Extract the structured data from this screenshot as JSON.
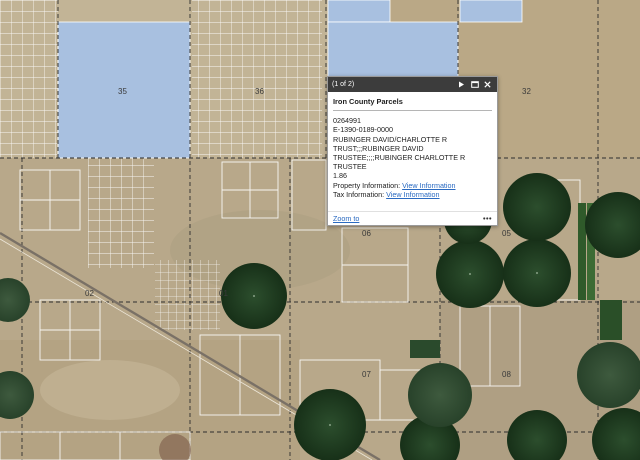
{
  "map": {
    "section_labels": [
      "35",
      "36",
      "32",
      "02",
      "01",
      "06",
      "05",
      "07",
      "08"
    ]
  },
  "popup": {
    "count": "(1 of 2)",
    "title": "Iron County Parcels",
    "parcel_id": "0264991",
    "account": "E-1390-0189-0000",
    "owner_line1": "RUBINGER DAVID/CHARLOTTE R",
    "owner_line2": "TRUST;;;RUBINGER DAVID",
    "owner_line3": "TRUSTEE;;;;RUBINGER CHARLOTTE R",
    "owner_line4": "TRUSTEE",
    "acres": "1.86",
    "property_label": "Property Information:",
    "property_link": "View Information",
    "tax_label": "Tax Information:",
    "tax_link": "View Information",
    "zoom_label": "Zoom to",
    "more_label": "•••"
  },
  "icons": {
    "next": "play-next-icon",
    "maximize": "maximize-icon",
    "close": "close-icon"
  },
  "colors": {
    "terrain": "#b9a98c",
    "parcel_highlight": "#a8c0e0",
    "crop_circle": "#1f3b22",
    "parcel_line": "#ffffff",
    "header": "#3c3c3c",
    "link": "#2a6ac1"
  }
}
